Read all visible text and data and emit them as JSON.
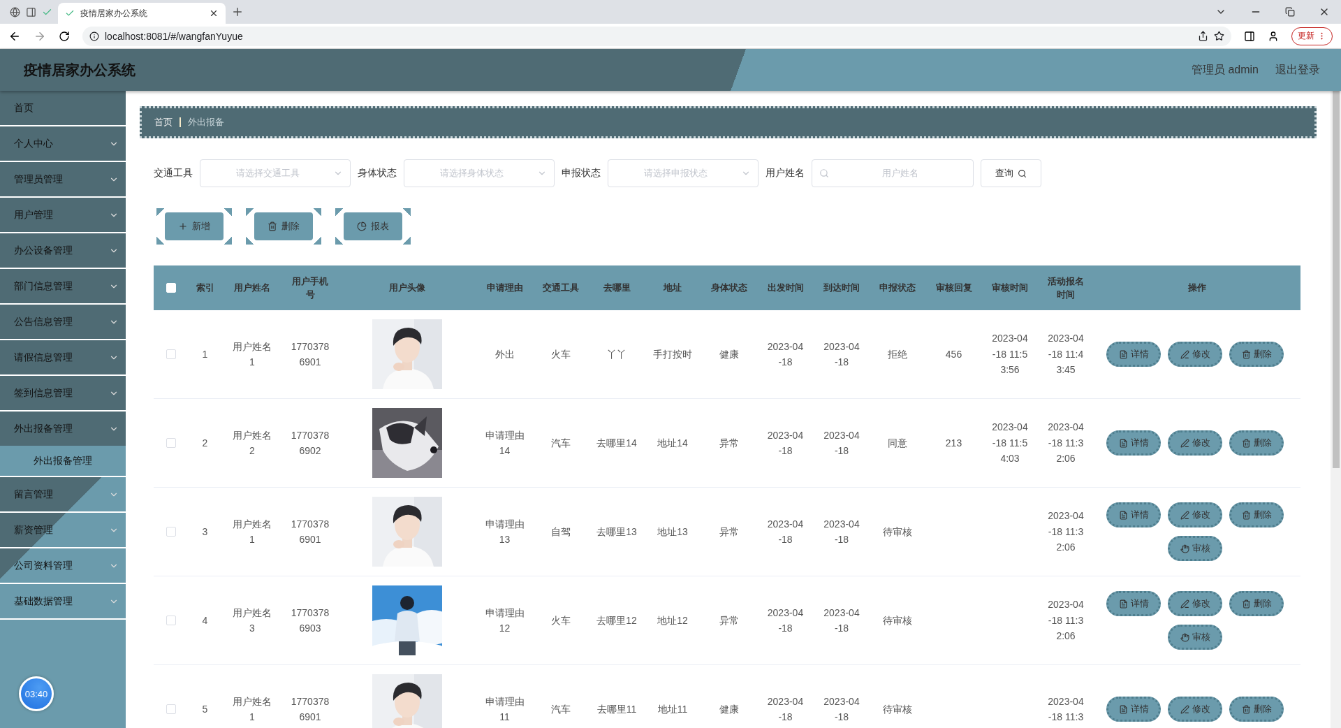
{
  "browser": {
    "tabs": [
      {
        "title": "疫情居家办公系统",
        "selected": true
      }
    ],
    "url": "localhost:8081/#/wangfanYuyue",
    "update_button": "更新"
  },
  "header": {
    "title": "疫情居家办公系统",
    "user": "管理员 admin",
    "logout": "退出登录"
  },
  "sidebar": {
    "items": [
      {
        "label": "首页",
        "expandable": false
      },
      {
        "label": "个人中心",
        "expandable": true
      },
      {
        "label": "管理员管理",
        "expandable": true
      },
      {
        "label": "用户管理",
        "expandable": true
      },
      {
        "label": "办公设备管理",
        "expandable": true
      },
      {
        "label": "部门信息管理",
        "expandable": true
      },
      {
        "label": "公告信息管理",
        "expandable": true
      },
      {
        "label": "请假信息管理",
        "expandable": true
      },
      {
        "label": "签到信息管理",
        "expandable": true
      },
      {
        "label": "外出报备管理",
        "expandable": true,
        "children": [
          {
            "label": "外出报备管理",
            "selected": true
          }
        ]
      },
      {
        "label": "留言管理",
        "expandable": true
      },
      {
        "label": "薪资管理",
        "expandable": true
      },
      {
        "label": "公司资料管理",
        "expandable": true
      },
      {
        "label": "基础数据管理",
        "expandable": true
      }
    ],
    "timer": "03:40"
  },
  "breadcrumb": [
    "首页",
    "外出报备"
  ],
  "filters": [
    {
      "kind": "select",
      "label": "交通工具",
      "placeholder": "请选择交通工具"
    },
    {
      "kind": "select",
      "label": "身体状态",
      "placeholder": "请选择身体状态"
    },
    {
      "kind": "select",
      "label": "申报状态",
      "placeholder": "请选择申报状态"
    },
    {
      "kind": "search",
      "label": "用户姓名",
      "placeholder": "用户姓名"
    }
  ],
  "query_button": "查询",
  "toolbar": [
    {
      "kind": "add",
      "label": "新增"
    },
    {
      "kind": "delete",
      "label": "删除"
    },
    {
      "kind": "report",
      "label": "报表"
    }
  ],
  "table": {
    "all_checked": false,
    "columns": [
      "索引",
      "用户姓名",
      "用户手机号",
      "用户头像",
      "申请理由",
      "交通工具",
      "去哪里",
      "地址",
      "身体状态",
      "出发时间",
      "到达时间",
      "申报状态",
      "审核回复",
      "审核时间",
      "活动报名时间",
      "操作"
    ],
    "rows": [
      {
        "checked": false,
        "index": "1",
        "name": "用户姓名1",
        "phone": "17703786901",
        "photo": {
          "kind": "picture"
        },
        "reason": "外出",
        "transport": "火车",
        "destination": "丫丫",
        "address": "手打按时",
        "health": "健康",
        "depart": "2023-04-18",
        "arrive": "2023-04-18",
        "status": "拒绝",
        "reply": "456",
        "review_time": "2023-04-18 11:53:56",
        "signup_time": "2023-04-18 11:43:45",
        "actions": [
          {
            "kind": "detail",
            "label": "详情"
          },
          {
            "kind": "edit",
            "label": "修改"
          },
          {
            "kind": "delete",
            "label": "删除"
          }
        ]
      },
      {
        "checked": false,
        "index": "2",
        "name": "用户姓名2",
        "phone": "17703786902",
        "photo": {
          "kind": "picture"
        },
        "reason": "申请理由14",
        "transport": "汽车",
        "destination": "去哪里14",
        "address": "地址14",
        "health": "异常",
        "depart": "2023-04-18",
        "arrive": "2023-04-18",
        "status": "同意",
        "reply": "213",
        "review_time": "2023-04-18 11:54:03",
        "signup_time": "2023-04-18 11:32:06",
        "actions": [
          {
            "kind": "detail",
            "label": "详情"
          },
          {
            "kind": "edit",
            "label": "修改"
          },
          {
            "kind": "delete",
            "label": "删除"
          }
        ]
      },
      {
        "checked": false,
        "index": "3",
        "name": "用户姓名1",
        "phone": "17703786901",
        "photo": {
          "kind": "picture"
        },
        "reason": "申请理由13",
        "transport": "自驾",
        "destination": "去哪里13",
        "address": "地址13",
        "health": "异常",
        "depart": "2023-04-18",
        "arrive": "2023-04-18",
        "status": "待审核",
        "signup_time": "2023-04-18 11:32:06",
        "actions": [
          {
            "kind": "detail",
            "label": "详情"
          },
          {
            "kind": "edit",
            "label": "修改"
          },
          {
            "kind": "delete",
            "label": "删除"
          },
          {
            "kind": "review",
            "label": "审核"
          }
        ]
      },
      {
        "checked": false,
        "index": "4",
        "name": "用户姓名3",
        "phone": "17703786903",
        "photo": {
          "kind": "picture"
        },
        "reason": "申请理由12",
        "transport": "火车",
        "destination": "去哪里12",
        "address": "地址12",
        "health": "异常",
        "depart": "2023-04-18",
        "arrive": "2023-04-18",
        "status": "待审核",
        "signup_time": "2023-04-18 11:32:06",
        "actions": [
          {
            "kind": "detail",
            "label": "详情"
          },
          {
            "kind": "edit",
            "label": "修改"
          },
          {
            "kind": "delete",
            "label": "删除"
          },
          {
            "kind": "review",
            "label": "审核"
          }
        ]
      },
      {
        "checked": false,
        "index": "5",
        "name": "用户姓名1",
        "phone": "17703786901",
        "photo": {
          "kind": "picture"
        },
        "reason": "申请理由11",
        "transport": "汽车",
        "destination": "去哪里11",
        "address": "地址11",
        "health": "健康",
        "depart": "2023-04-18",
        "arrive": "2023-04-18",
        "status": "待审核",
        "signup_time": "2023-04-18 11:3",
        "actions": [
          {
            "kind": "detail",
            "label": "详情"
          },
          {
            "kind": "edit",
            "label": "修改"
          },
          {
            "kind": "delete",
            "label": "删除"
          }
        ]
      }
    ]
  }
}
